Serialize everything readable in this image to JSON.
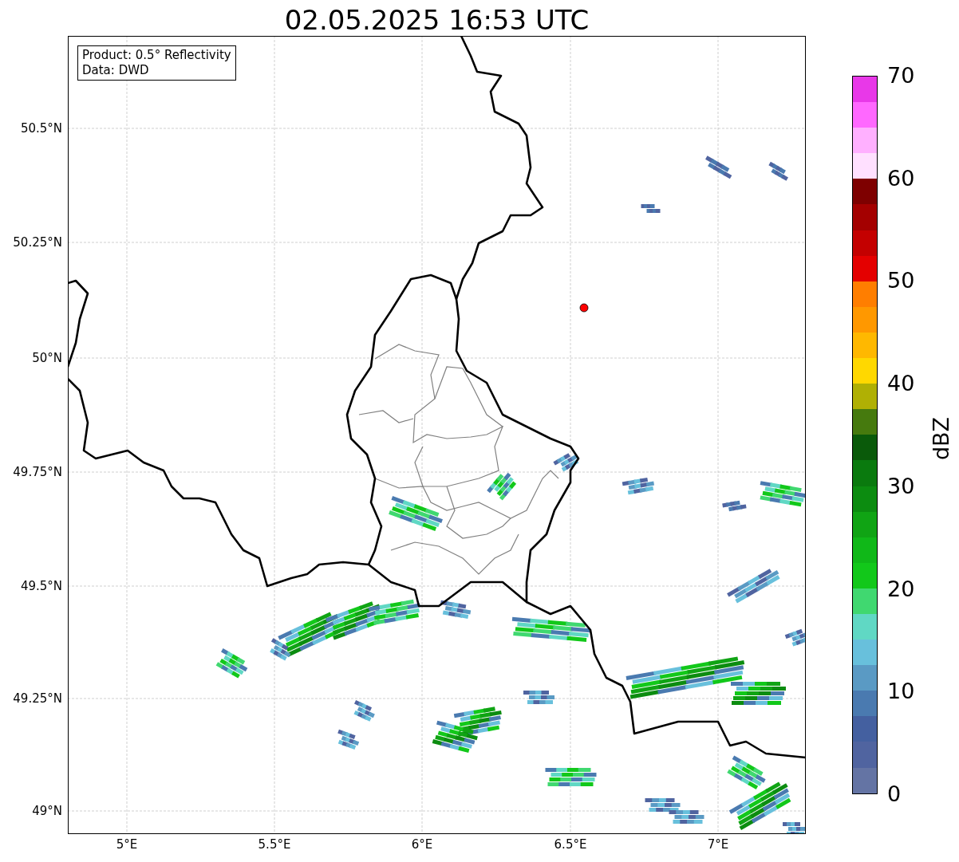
{
  "title": "02.05.2025 16:53 UTC",
  "map": {
    "legend": [
      "Product: 0.5° Reflectivity",
      "Data: DWD"
    ],
    "lat_ticks": [
      "50.5°N",
      "50.25°N",
      "50°N",
      "49.75°N",
      "49.5°N",
      "49.25°N",
      "49°N"
    ],
    "lon_ticks": [
      "5°E",
      "5.5°E",
      "6°E",
      "6.5°E",
      "7°E"
    ],
    "site_marker": {
      "color": "#ff0000"
    }
  },
  "colorbar": {
    "label": "dBZ",
    "ticks": [
      "70",
      "60",
      "50",
      "40",
      "30",
      "20",
      "10",
      "0"
    ],
    "bins": [
      {
        "color": "#e838e8"
      },
      {
        "color": "#ff68ff"
      },
      {
        "color": "#ffb0ff"
      },
      {
        "color": "#ffe0ff"
      },
      {
        "color": "#7e0000"
      },
      {
        "color": "#a40000"
      },
      {
        "color": "#c40000"
      },
      {
        "color": "#e40000"
      },
      {
        "color": "#ff7e00"
      },
      {
        "color": "#ff9800"
      },
      {
        "color": "#ffb800"
      },
      {
        "color": "#ffd800"
      },
      {
        "color": "#b0b004"
      },
      {
        "color": "#467a0e"
      },
      {
        "color": "#0a5a0a"
      },
      {
        "color": "#0a7a0e"
      },
      {
        "color": "#0c8c10"
      },
      {
        "color": "#10a414"
      },
      {
        "color": "#10b818"
      },
      {
        "color": "#12c81a"
      },
      {
        "color": "#40d870"
      },
      {
        "color": "#60d8c4"
      },
      {
        "color": "#68c0dc"
      },
      {
        "color": "#5a9ac4"
      },
      {
        "color": "#4a7ab0"
      },
      {
        "color": "#4460a0"
      },
      {
        "color": "#5064a0"
      },
      {
        "color": "#6474a4"
      }
    ]
  }
}
